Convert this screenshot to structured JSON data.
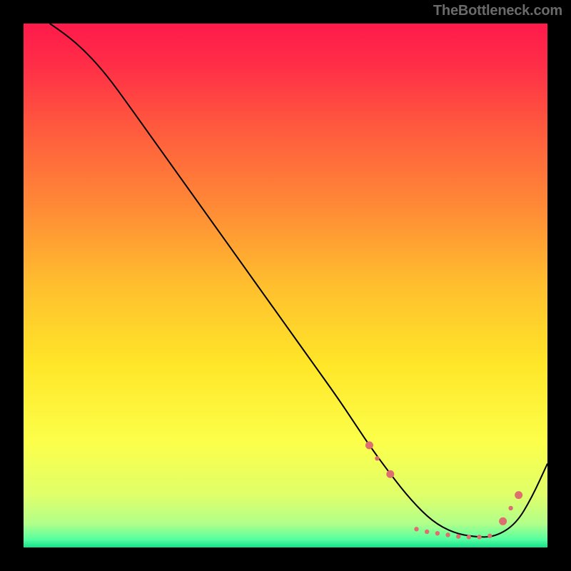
{
  "watermark": "TheBottleneck.com",
  "chart_data": {
    "type": "line",
    "title": "",
    "xlabel": "",
    "ylabel": "",
    "xlim": [
      0,
      100
    ],
    "ylim": [
      0,
      100
    ],
    "grid": false,
    "gradient": {
      "stops": [
        {
          "offset": 0.0,
          "color": "#ff1a4b"
        },
        {
          "offset": 0.08,
          "color": "#ff2e47"
        },
        {
          "offset": 0.2,
          "color": "#ff5a3e"
        },
        {
          "offset": 0.35,
          "color": "#ff8a36"
        },
        {
          "offset": 0.5,
          "color": "#ffbf2e"
        },
        {
          "offset": 0.65,
          "color": "#ffe628"
        },
        {
          "offset": 0.8,
          "color": "#fcff4a"
        },
        {
          "offset": 0.9,
          "color": "#e0ff6a"
        },
        {
          "offset": 0.955,
          "color": "#b0ff8a"
        },
        {
          "offset": 0.985,
          "color": "#55ffa0"
        },
        {
          "offset": 1.0,
          "color": "#14e08a"
        }
      ]
    },
    "series": [
      {
        "name": "curve",
        "color": "#000000",
        "width": 2,
        "x": [
          5,
          8,
          12,
          16,
          20,
          25,
          30,
          35,
          40,
          45,
          50,
          55,
          60,
          63,
          66,
          70,
          74,
          78,
          82,
          86,
          90,
          94,
          97,
          100
        ],
        "y": [
          100,
          98,
          94.5,
          90,
          84.5,
          77.5,
          70.5,
          63.5,
          56.5,
          49.5,
          42.5,
          35.5,
          28.5,
          24,
          19.5,
          14,
          9,
          5,
          2.8,
          2.0,
          2.0,
          4.5,
          9.5,
          16
        ]
      }
    ],
    "highlight_points": {
      "color": "#dd6f6f",
      "radius_small": 3.2,
      "radius_large": 5.5,
      "points": [
        {
          "x": 66,
          "y": 19.5,
          "r": "large"
        },
        {
          "x": 67.5,
          "y": 17.0,
          "r": "small"
        },
        {
          "x": 70,
          "y": 14,
          "r": "large"
        },
        {
          "x": 75,
          "y": 3.5,
          "r": "small"
        },
        {
          "x": 77,
          "y": 3.0,
          "r": "small"
        },
        {
          "x": 79,
          "y": 2.7,
          "r": "small"
        },
        {
          "x": 81,
          "y": 2.4,
          "r": "small"
        },
        {
          "x": 83,
          "y": 2.1,
          "r": "small"
        },
        {
          "x": 85,
          "y": 2.0,
          "r": "small"
        },
        {
          "x": 87,
          "y": 2.0,
          "r": "small"
        },
        {
          "x": 89,
          "y": 2.2,
          "r": "small"
        },
        {
          "x": 91.5,
          "y": 5.0,
          "r": "large"
        },
        {
          "x": 93,
          "y": 7.5,
          "r": "small"
        },
        {
          "x": 94.5,
          "y": 10,
          "r": "large"
        }
      ]
    }
  }
}
